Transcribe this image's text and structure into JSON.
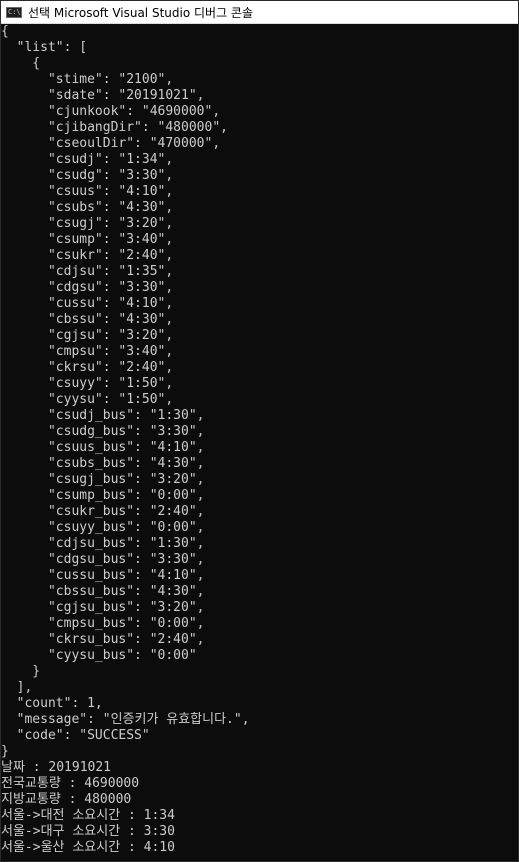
{
  "window": {
    "title": "선택 Microsoft Visual Studio 디버그 콘솔",
    "icon": "console-app-icon",
    "icon_glyph": "C:\\"
  },
  "colors": {
    "console_background": "#0c0c0c",
    "console_text": "#cccccc",
    "titlebar_background": "#ffffff"
  },
  "console": {
    "lines": [
      "{",
      "  \"list\": [",
      "    {",
      "      \"stime\": \"2100\",",
      "      \"sdate\": \"20191021\",",
      "      \"cjunkook\": \"4690000\",",
      "      \"cjibangDir\": \"480000\",",
      "      \"cseoulDir\": \"470000\",",
      "      \"csudj\": \"1:34\",",
      "      \"csudg\": \"3:30\",",
      "      \"csuus\": \"4:10\",",
      "      \"csubs\": \"4:30\",",
      "      \"csugj\": \"3:20\",",
      "      \"csump\": \"3:40\",",
      "      \"csukr\": \"2:40\",",
      "      \"cdjsu\": \"1:35\",",
      "      \"cdgsu\": \"3:30\",",
      "      \"cussu\": \"4:10\",",
      "      \"cbssu\": \"4:30\",",
      "      \"cgjsu\": \"3:20\",",
      "      \"cmpsu\": \"3:40\",",
      "      \"ckrsu\": \"2:40\",",
      "      \"csuyy\": \"1:50\",",
      "      \"cyysu\": \"1:50\",",
      "      \"csudj_bus\": \"1:30\",",
      "      \"csudg_bus\": \"3:30\",",
      "      \"csuus_bus\": \"4:10\",",
      "      \"csubs_bus\": \"4:30\",",
      "      \"csugj_bus\": \"3:20\",",
      "      \"csump_bus\": \"0:00\",",
      "      \"csukr_bus\": \"2:40\",",
      "      \"csuyy_bus\": \"0:00\",",
      "      \"cdjsu_bus\": \"1:30\",",
      "      \"cdgsu_bus\": \"3:30\",",
      "      \"cussu_bus\": \"4:10\",",
      "      \"cbssu_bus\": \"4:30\",",
      "      \"cgjsu_bus\": \"3:20\",",
      "      \"cmpsu_bus\": \"0:00\",",
      "      \"ckrsu_bus\": \"2:40\",",
      "      \"cyysu_bus\": \"0:00\"",
      "    }",
      "  ],",
      "  \"count\": 1,",
      "  \"message\": \"인증키가 유효합니다.\",",
      "  \"code\": \"SUCCESS\"",
      "}",
      "날짜 : 20191021",
      "전국교통량 : 4690000",
      "지방교통량 : 480000",
      "서울->대전 소요시간 : 1:34",
      "서울->대구 소요시간 : 3:30",
      "서울->울산 소요시간 : 4:10"
    ]
  }
}
